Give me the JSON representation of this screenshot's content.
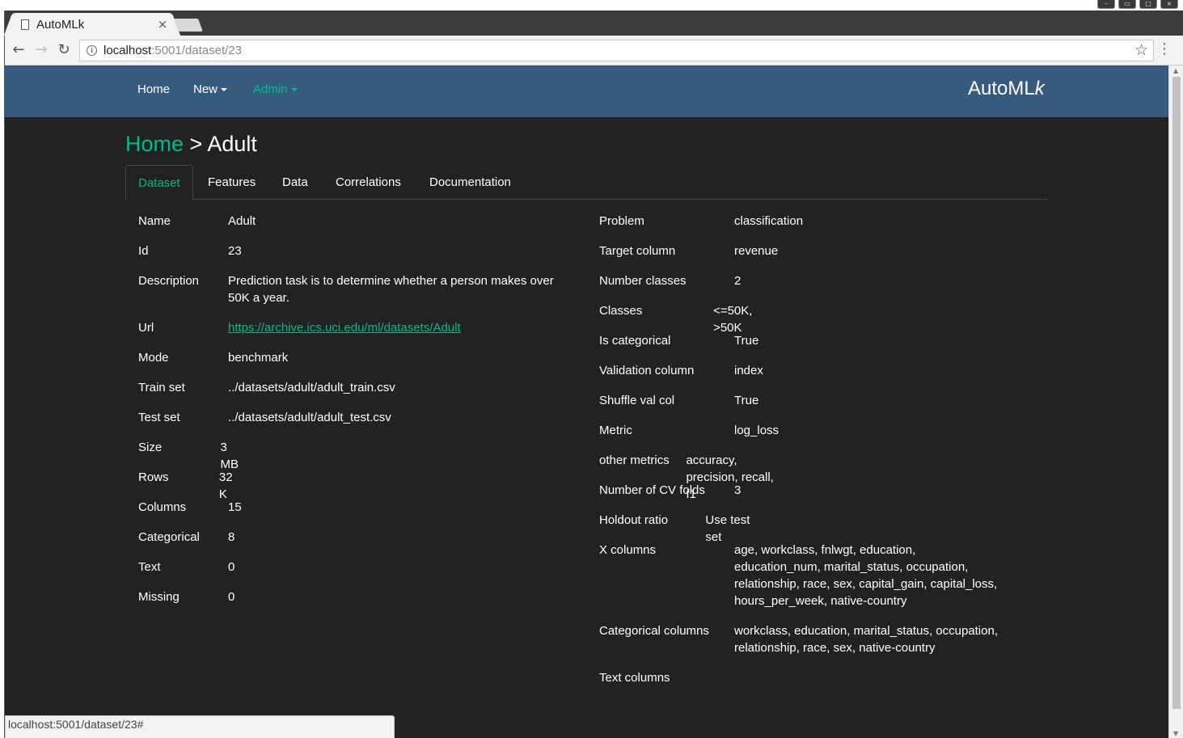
{
  "browser": {
    "tab_title": "AutoMLk",
    "tab_close": "×",
    "url_host": "localhost",
    "url_rest": ":5001/dataset/23",
    "status_url": "localhost:5001/dataset/23#"
  },
  "navbar": {
    "home": "Home",
    "new": "New",
    "admin": "Admin",
    "brand_main": "AutoML",
    "brand_k": "k",
    "colors": {
      "bg": "#375a7f",
      "accent": "#00bc8c"
    }
  },
  "breadcrumb": {
    "home": "Home",
    "sep": " > ",
    "current": "Adult"
  },
  "tabs": [
    "Dataset",
    "Features",
    "Data",
    "Correlations",
    "Documentation"
  ],
  "left": {
    "name_label": "Name",
    "name": "Adult",
    "id_label": "Id",
    "id": "23",
    "description_label": "Description",
    "description": "Prediction task is to determine whether a person makes over 50K a year.",
    "url_label": "Url",
    "url": "https://archive.ics.uci.edu/ml/datasets/Adult",
    "mode_label": "Mode",
    "mode": "benchmark",
    "train_label": "Train set",
    "train": "../datasets/adult/adult_train.csv",
    "test_label": "Test set",
    "test": "../datasets/adult/adult_test.csv",
    "size_label": "Size",
    "size": "3 MB",
    "rows_label": "Rows",
    "rows": "32 K",
    "columns_label": "Columns",
    "columns": "15",
    "categorical_label": "Categorical",
    "categorical": "8",
    "text_label": "Text",
    "text": "0",
    "missing_label": "Missing",
    "missing": "0"
  },
  "right": {
    "problem_label": "Problem",
    "problem": "classification",
    "target_label": "Target column",
    "target": "revenue",
    "nclasses_label": "Number classes",
    "nclasses": "2",
    "classes_label": "Classes",
    "classes": "<=50K, >50K",
    "iscat_label": "Is categorical",
    "iscat": "True",
    "valcol_label": "Validation column",
    "valcol": "index",
    "shuffle_label": "Shuffle val col",
    "shuffle": "True",
    "metric_label": "Metric",
    "metric": "log_loss",
    "other_label": "other metrics",
    "other": "accuracy, precision, recall, f1",
    "cv_label": "Number of CV folds",
    "cv": "3",
    "holdout_label": "Holdout ratio",
    "holdout": "Use test set",
    "xcols_label": "X columns",
    "xcols": "age, workclass, fnlwgt, education, education_num, marital_status, occupation, relationship, race, sex, capital_gain, capital_loss, hours_per_week, native-country",
    "catcols_label": "Categorical columns",
    "catcols": "workclass, education, marital_status, occupation, relationship, race, sex, native-country",
    "textcols_label": "Text columns",
    "textcols": ""
  }
}
